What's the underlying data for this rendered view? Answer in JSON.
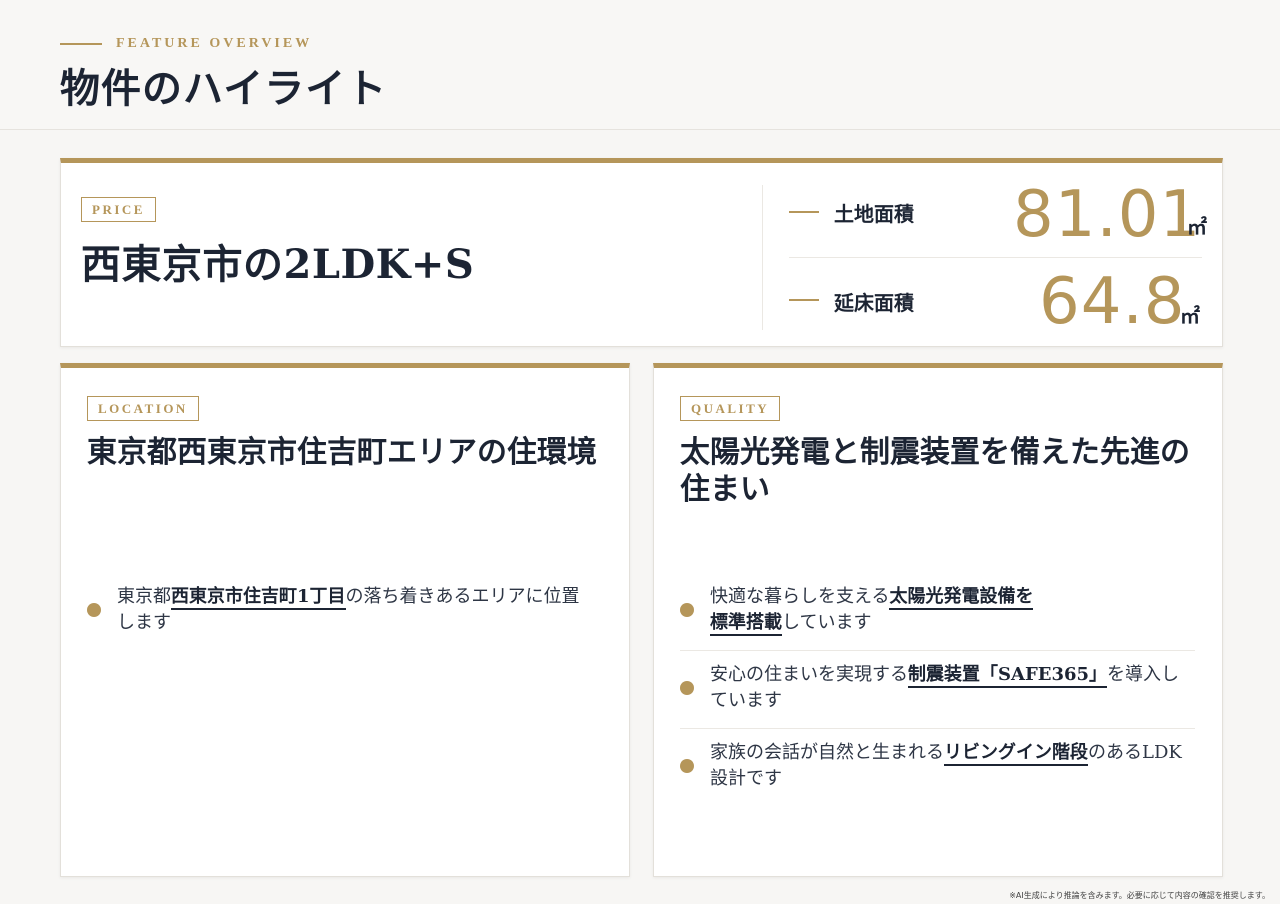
{
  "header": {
    "eyebrow": "FEATURE OVERVIEW",
    "title": "物件のハイライト"
  },
  "price_card": {
    "tag": "PRICE",
    "title": "西東京市の2LDK+S",
    "areas": [
      {
        "label": "土地面積",
        "value": "81.01",
        "unit": "㎡"
      },
      {
        "label": "延床面積",
        "value": "64.8",
        "unit": "㎡"
      }
    ]
  },
  "location_card": {
    "tag": "LOCATION",
    "heading": "東京都西東京市住吉町エリアの住環境",
    "bullets": [
      {
        "pre": "東京都",
        "bold": "西東京市住吉町1丁目",
        "post": "の落ち着きあるエリアに位置します"
      }
    ]
  },
  "quality_card": {
    "tag": "QUALITY",
    "heading": "太陽光発電と制震装置を備えた先進の住まい",
    "bullets": [
      {
        "pre": "快適な暮らしを支える",
        "bold": "太陽光発電設備を",
        "bold2": "標準搭載",
        "post": "しています"
      },
      {
        "pre": "安心の住まいを実現する",
        "bold": "制震装置「SAFE365」",
        "post": "を導入しています"
      },
      {
        "pre": "家族の会話が自然と生まれる",
        "bold": "リビングイン階段",
        "post": "のあるLDK設計です"
      }
    ]
  },
  "footer": {
    "disclaimer": "※AI生成により推論を含みます。必要に応じて内容の確認を推奨します。"
  },
  "colors": {
    "accent": "#b5965a",
    "text": "#1c2433",
    "background": "#f7f6f4"
  }
}
